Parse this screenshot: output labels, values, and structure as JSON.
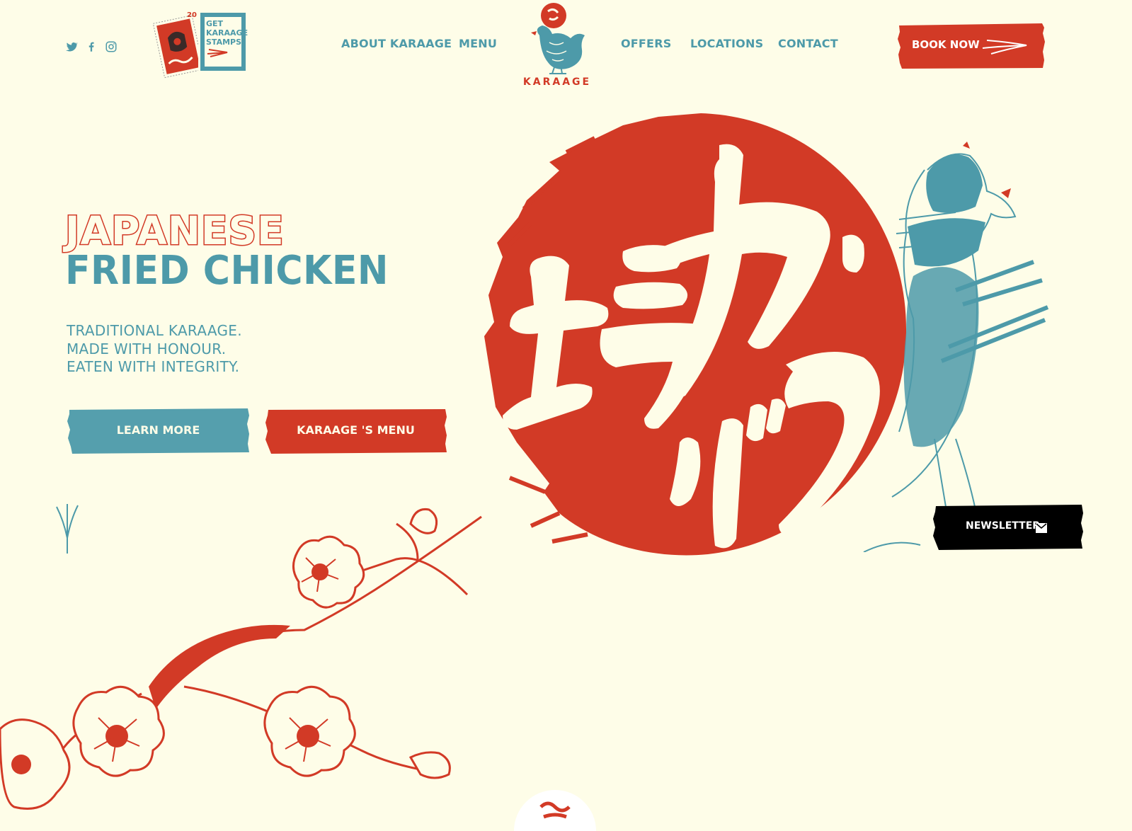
{
  "colors": {
    "background": "#fefde8",
    "red": "#d23a26",
    "teal": "#4d9aa9",
    "black": "#000000"
  },
  "social": [
    {
      "icon": "twitter-icon"
    },
    {
      "icon": "facebook-icon"
    },
    {
      "icon": "instagram-icon"
    }
  ],
  "stamp_promo": {
    "badge_number": "20",
    "lines": [
      "GET",
      "KARAAGE",
      "STAMPS!"
    ]
  },
  "nav": {
    "left": [
      "ABOUT KARAAGE",
      "MENU"
    ],
    "right": [
      "OFFERS",
      "LOCATIONS",
      "CONTACT"
    ]
  },
  "logo": {
    "text": "KARAAGE",
    "icon": "rooster-logo-icon"
  },
  "book_now": {
    "label": "BOOK NOW",
    "icon": "arrow-icon"
  },
  "hero": {
    "title_top": "JAPANESE",
    "title_bottom": "FRIED CHICKEN",
    "tagline": [
      "TRADITIONAL KARAAGE.",
      "MADE WITH HONOUR.",
      "EATEN WITH INTEGRITY."
    ],
    "calligraphy_icon": "karaage-calligraphy-icon",
    "rooster_icon": "samurai-rooster-icon"
  },
  "buttons": {
    "learn_more": "LEARN MORE",
    "menu": "KARAAGE 'S MENU"
  },
  "newsletter": {
    "label": "NEWSLETTER",
    "icon": "mail-icon"
  },
  "decor": {
    "blossom_icon": "cherry-blossom-icon",
    "scroll_icon": "scroll-down-icon"
  }
}
